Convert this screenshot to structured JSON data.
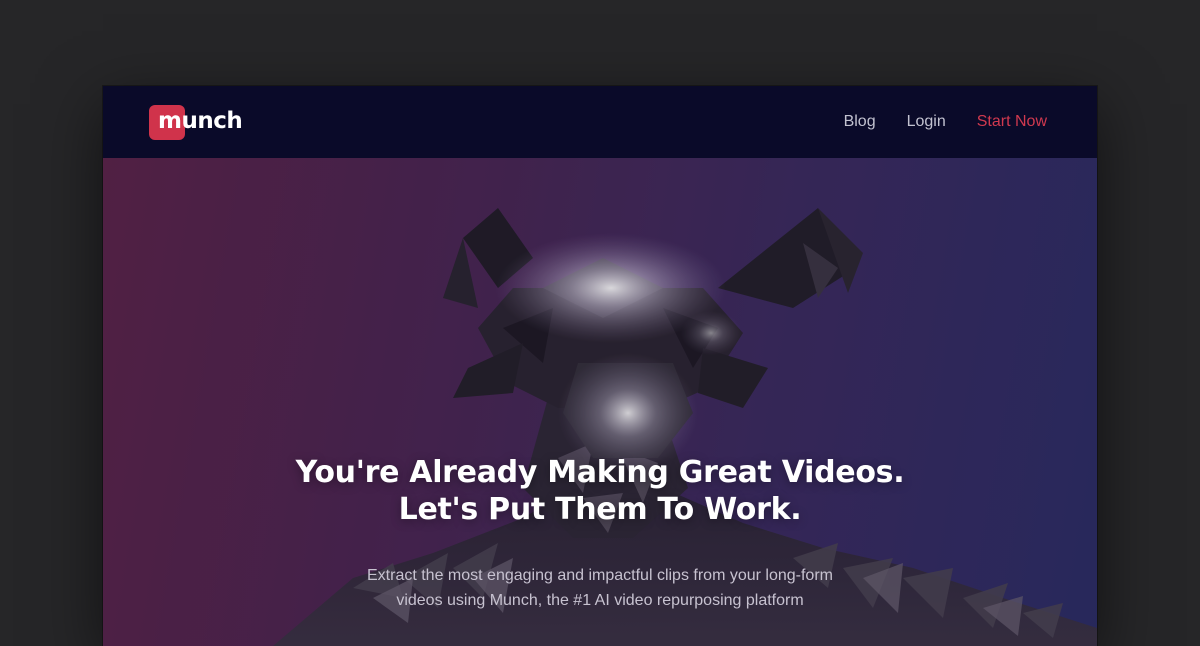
{
  "brand": {
    "name": "munch",
    "accent_color": "#d0334b"
  },
  "nav": {
    "links": [
      {
        "label": "Blog"
      },
      {
        "label": "Login"
      },
      {
        "label": "Start Now",
        "color": "#d0394f"
      }
    ]
  },
  "hero": {
    "headline_line1": "You're Already Making Great Videos.",
    "headline_line2": "Let's Put Them To Work.",
    "subtext_line1": "Extract the most engaging and impactful clips from your long-form",
    "subtext_line2": "videos using Munch, the #1 AI video repurposing platform",
    "background_image": "mirrored-bull-mask-figure"
  }
}
